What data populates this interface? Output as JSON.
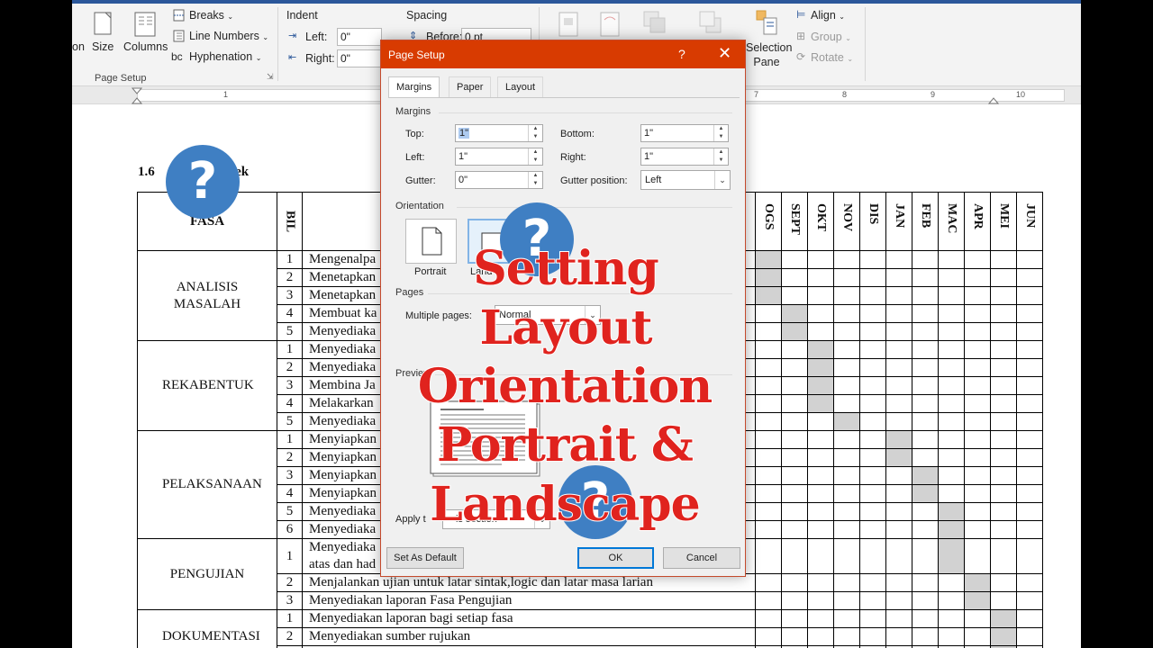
{
  "ribbon": {
    "margins_partial": "on",
    "size": "Size",
    "columns": "Columns",
    "breaks": "Breaks",
    "line_numbers": "Line Numbers",
    "hyphenation": "Hyphenation",
    "page_setup_group": "Page Setup",
    "indent": "Indent",
    "left": "Left:",
    "right": "Right:",
    "indent_left_value": "0\"",
    "indent_right_value": "0\"",
    "spacing": "Spacing",
    "before": "Before:",
    "before_value": "0 pt",
    "selection_pane": "Selection Pane",
    "align": "Align",
    "group": "Group",
    "rotate": "Rotate",
    "accent": "#2b579a"
  },
  "ruler": {
    "ticks_left": [
      "1"
    ],
    "ticks_right": [
      "7",
      "8",
      "9",
      "10"
    ]
  },
  "document": {
    "heading_prefix": "1.6",
    "heading_suffix": "pjek",
    "header_fasa": "FASA",
    "header_bil": "BIL",
    "months": [
      "OGS",
      "SEPT",
      "OKT",
      "NOV",
      "DIS",
      "JAN",
      "FEB",
      "MAC",
      "APR",
      "MEI",
      "JUN"
    ],
    "phases": [
      {
        "name": "ANALISIS MASALAH",
        "rows": [
          {
            "bil": "1",
            "task": "Mengenalpa",
            "shade": [
              0
            ]
          },
          {
            "bil": "2",
            "task": "Menetapkan",
            "shade": [
              0
            ]
          },
          {
            "bil": "3",
            "task": "Menetapkan",
            "shade": [
              0
            ]
          },
          {
            "bil": "4",
            "task": "Membuat ka",
            "shade": [
              1
            ]
          },
          {
            "bil": "5",
            "task": "Menyediaka",
            "shade": [
              1
            ]
          }
        ]
      },
      {
        "name": "REKABENTUK",
        "rows": [
          {
            "bil": "1",
            "task": "Menyediaka",
            "shade": [
              2
            ]
          },
          {
            "bil": "2",
            "task": "Menyediaka",
            "shade": [
              2
            ]
          },
          {
            "bil": "3",
            "task": "Membina Ja",
            "shade": [
              2
            ]
          },
          {
            "bil": "4",
            "task": "Melakarkan",
            "shade": [
              2
            ]
          },
          {
            "bil": "5",
            "task": "Menyediaka",
            "shade": [
              3
            ]
          }
        ]
      },
      {
        "name": "PELAKSANAAN",
        "rows": [
          {
            "bil": "1",
            "task": "Menyiapkan",
            "shade": [
              5
            ]
          },
          {
            "bil": "2",
            "task": "Menyiapkan",
            "shade": [
              5
            ]
          },
          {
            "bil": "3",
            "task": "Menyiapkan",
            "shade": [
              6
            ]
          },
          {
            "bil": "4",
            "task": "Menyiapkan",
            "shade": [
              6
            ]
          },
          {
            "bil": "5",
            "task": "Menyediaka",
            "shade": [
              7
            ]
          },
          {
            "bil": "6",
            "task": "Menyediaka",
            "shade": [
              7
            ]
          }
        ]
      },
      {
        "name": "PENGUJIAN",
        "rows": [
          {
            "bil": "1",
            "task": "Menyediaka",
            "task2": "atas dan had",
            "shade": [
              7
            ],
            "tall": true
          },
          {
            "bil": "2",
            "task": "Menjalankan ujian untuk latar sintak,logic dan latar masa larian",
            "shade": [
              8
            ]
          },
          {
            "bil": "3",
            "task": "Menyediakan laporan Fasa Pengujian",
            "shade": [
              8
            ]
          }
        ]
      },
      {
        "name": "DOKUMENTASI",
        "rows": [
          {
            "bil": "1",
            "task": "Menyediakan laporan bagi setiap fasa",
            "shade": [
              9
            ]
          },
          {
            "bil": "2",
            "task": "Menyediakan sumber rujukan",
            "shade": [
              9
            ]
          },
          {
            "bil": "3",
            "task": "Menyediakan penghargaan",
            "shade": [
              9
            ]
          }
        ]
      }
    ]
  },
  "dialog": {
    "title": "Page Setup",
    "help": "?",
    "close": "✕",
    "tabs": [
      "Margins",
      "Paper",
      "Layout"
    ],
    "margins_group": "Margins",
    "top_label": "Top:",
    "top_value": "1\"",
    "bottom_label": "Bottom:",
    "bottom_value": "1\"",
    "left_label": "Left:",
    "left_value": "1\"",
    "right_label": "Right:",
    "right_value": "1\"",
    "gutter_label": "Gutter:",
    "gutter_value": "0\"",
    "gutter_pos_label": "Gutter position:",
    "gutter_pos_value": "Left",
    "orientation_group": "Orientation",
    "portrait": "Portrait",
    "landscape_partial": "Land",
    "pages_group": "Pages",
    "multiple_pages_label": "Multiple pages:",
    "multiple_pages_value": "Normal",
    "preview_group": "Preview",
    "apply_to_partial": "Apply t",
    "apply_to_value_partial": "is section",
    "set_default": "Set As Default",
    "ok": "OK",
    "cancel": "Cancel",
    "titlebar_color": "#d83b01"
  },
  "overlay": {
    "lines": [
      "Setting",
      "Layout",
      "Orientation",
      "Portrait &",
      "Landscape"
    ],
    "badge": "?",
    "text_color": "#e0231e",
    "badge_color": "#3f7fc3"
  }
}
